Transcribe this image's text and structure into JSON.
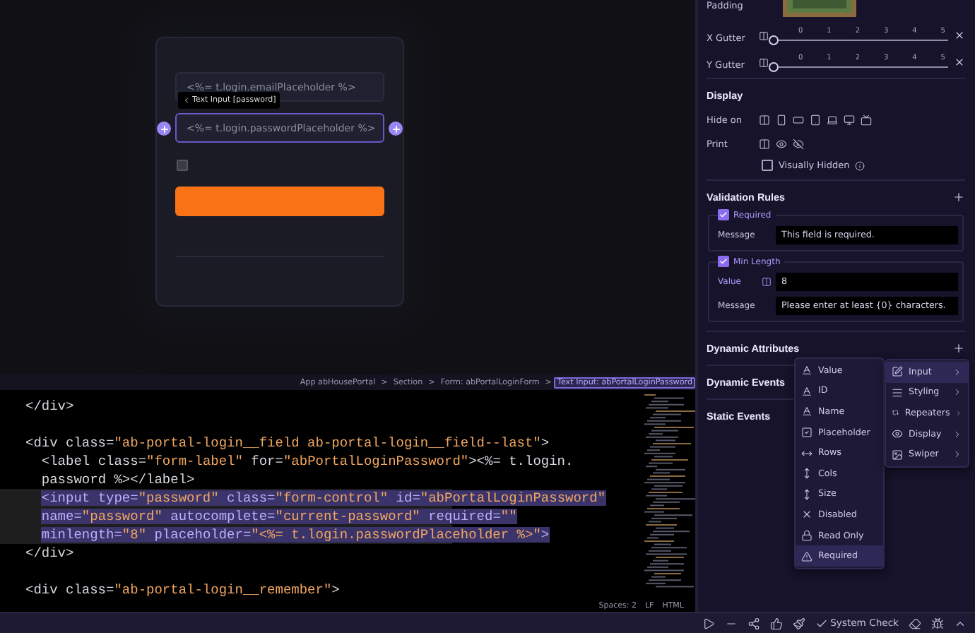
{
  "canvas": {
    "email_placeholder": "<%= t.login.emailPlaceholder %>",
    "password_placeholder": "<%= t.login.passwordPlaceholder %>",
    "selection_tooltip": "Text Input [password]",
    "remember_checked": false
  },
  "breadcrumb": {
    "separator": ">",
    "items": [
      {
        "label": "App abHousePortal",
        "selected": false
      },
      {
        "label": "Section",
        "selected": false
      },
      {
        "label": "Form: abPortalLoginForm",
        "selected": false
      },
      {
        "label": "Text Input: abPortalLoginPassword",
        "selected": true
      }
    ]
  },
  "code": {
    "lines": [
      {
        "text": "</div>",
        "highlighted": false
      },
      {
        "highlighted": false
      },
      {
        "text": "<div class=\"ab-portal-login__field ab-portal-login__field--last\">",
        "highlighted": false
      },
      {
        "text": "  <label class=\"form-label\" for=\"abPortalLoginPassword\"><%= t.login.",
        "highlighted": false
      },
      {
        "text": "  password %></label>",
        "highlighted": false
      },
      {
        "text": "  <input type=\"password\" class=\"form-control\" id=\"abPortalLoginPassword\"",
        "highlighted": true
      },
      {
        "text": "  name=\"password\" autocomplete=\"current-password\" required=\"\"",
        "highlighted": true
      },
      {
        "text": "  minlength=\"8\" placeholder=\"<%= t.login.passwordPlaceholder %>\">",
        "highlighted": true
      },
      {
        "text": "</div>",
        "highlighted": false
      },
      {
        "highlighted": false
      },
      {
        "text": "<div class=\"ab-portal-login__remember\">",
        "highlighted": false
      }
    ],
    "status": [
      "Spaces: 2",
      "LF",
      "HTML"
    ]
  },
  "properties": {
    "padding_label": "Padding",
    "gutters": [
      {
        "label": "X Gutter",
        "ticks": [
          "0",
          "1",
          "2",
          "3",
          "4",
          "5"
        ],
        "level": 0
      },
      {
        "label": "Y Gutter",
        "ticks": [
          "0",
          "1",
          "2",
          "3",
          "4",
          "5"
        ],
        "level": 0
      }
    ],
    "display": {
      "title": "Display",
      "hide_on_label": "Hide on",
      "print_label": "Print",
      "visually_hidden": {
        "label": "Visually Hidden",
        "checked": false
      }
    },
    "validation": {
      "title": "Validation Rules",
      "rules": [
        {
          "name": "Required",
          "checked": true,
          "fields": [
            {
              "label": "Message",
              "value": "This field is required.",
              "bound": false
            }
          ]
        },
        {
          "name": "Min Length",
          "checked": true,
          "fields": [
            {
              "label": "Value",
              "value": "8",
              "bound": true
            },
            {
              "label": "Message",
              "value": "Please enter at least {0} characters.",
              "bound": false
            }
          ]
        }
      ]
    },
    "sections": [
      {
        "title": "Dynamic Attributes",
        "addable": true
      },
      {
        "title": "Dynamic Events"
      },
      {
        "title": "Static Events"
      }
    ]
  },
  "attribute_menu": {
    "items": [
      {
        "label": "Input",
        "kind": "input",
        "selected": true
      },
      {
        "label": "Styling",
        "kind": "styling",
        "selected": false
      },
      {
        "label": "Repeaters",
        "kind": "repeaters",
        "selected": false
      },
      {
        "label": "Display",
        "kind": "display",
        "selected": false
      },
      {
        "label": "Swiper",
        "kind": "swiper",
        "selected": false
      }
    ],
    "submenu": [
      {
        "label": "Value",
        "kind": "text",
        "selected": false
      },
      {
        "label": "ID",
        "kind": "text",
        "selected": false
      },
      {
        "label": "Name",
        "kind": "text",
        "selected": false
      },
      {
        "label": "Placeholder",
        "kind": "check",
        "selected": false
      },
      {
        "label": "Rows",
        "kind": "rows",
        "selected": false
      },
      {
        "label": "Cols",
        "kind": "vertical",
        "selected": false
      },
      {
        "label": "Size",
        "kind": "vertical",
        "selected": false
      },
      {
        "label": "Disabled",
        "kind": "cross",
        "selected": false
      },
      {
        "label": "Read Only",
        "kind": "lock",
        "selected": false
      },
      {
        "label": "Required",
        "kind": "warning",
        "selected": true
      }
    ]
  },
  "bottom_bar": {
    "system_check": "System Check"
  }
}
